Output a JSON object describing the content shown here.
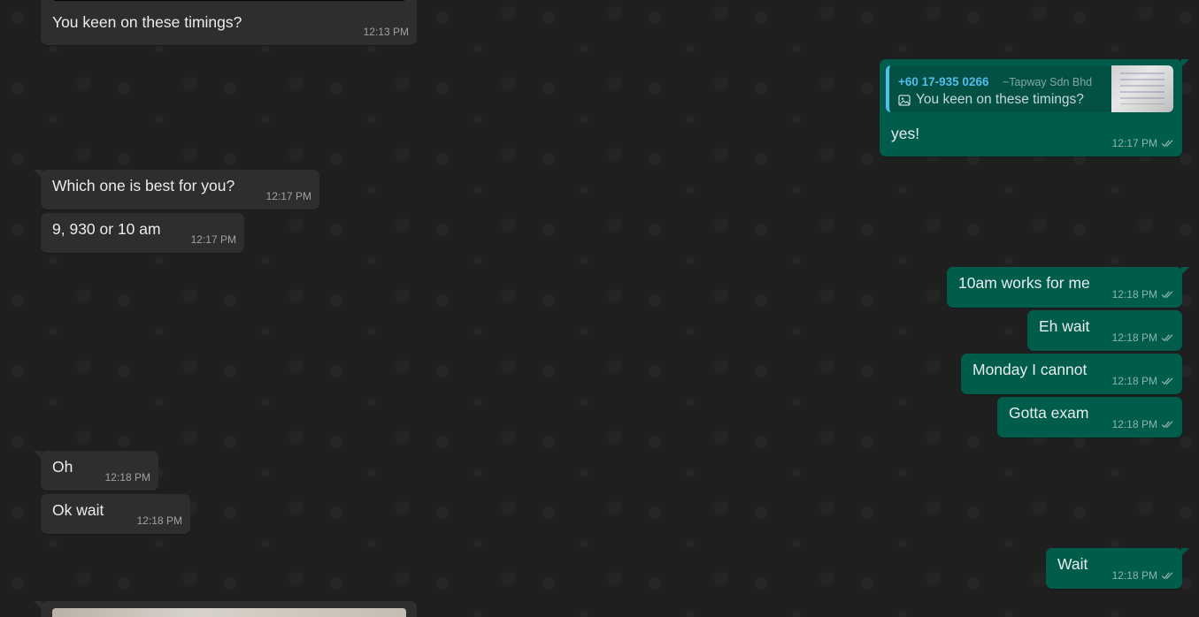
{
  "messages": {
    "m1": {
      "text": "You keen on these timings?",
      "time": "12:13 PM"
    },
    "m2": {
      "quote": {
        "sender": "+60 17-935 0266",
        "pushname": "~Tapway Sdn Bhd",
        "text": "You keen on these timings?",
        "icon": "image-icon"
      },
      "text": "yes!",
      "time": "12:17 PM"
    },
    "m3": {
      "text": "Which one is best for you?",
      "time": "12:17 PM"
    },
    "m4": {
      "text": "9, 930 or 10 am",
      "time": "12:17 PM"
    },
    "m5": {
      "text": "10am works for me",
      "time": "12:18 PM"
    },
    "m6": {
      "text": "Eh wait",
      "time": "12:18 PM"
    },
    "m7": {
      "text": "Monday I cannot",
      "time": "12:18 PM"
    },
    "m8": {
      "text": "Gotta exam",
      "time": "12:18 PM"
    },
    "m9": {
      "text": "Oh",
      "time": "12:18 PM"
    },
    "m10": {
      "text": "Ok wait",
      "time": "12:18 PM"
    },
    "m11": {
      "text": "Wait",
      "time": "12:18 PM"
    }
  },
  "colors": {
    "background": "#1f1f1f",
    "incoming_bubble": "#2e2e2e",
    "outgoing_bubble": "#005c4b",
    "quote_accent": "#53bdeb"
  }
}
